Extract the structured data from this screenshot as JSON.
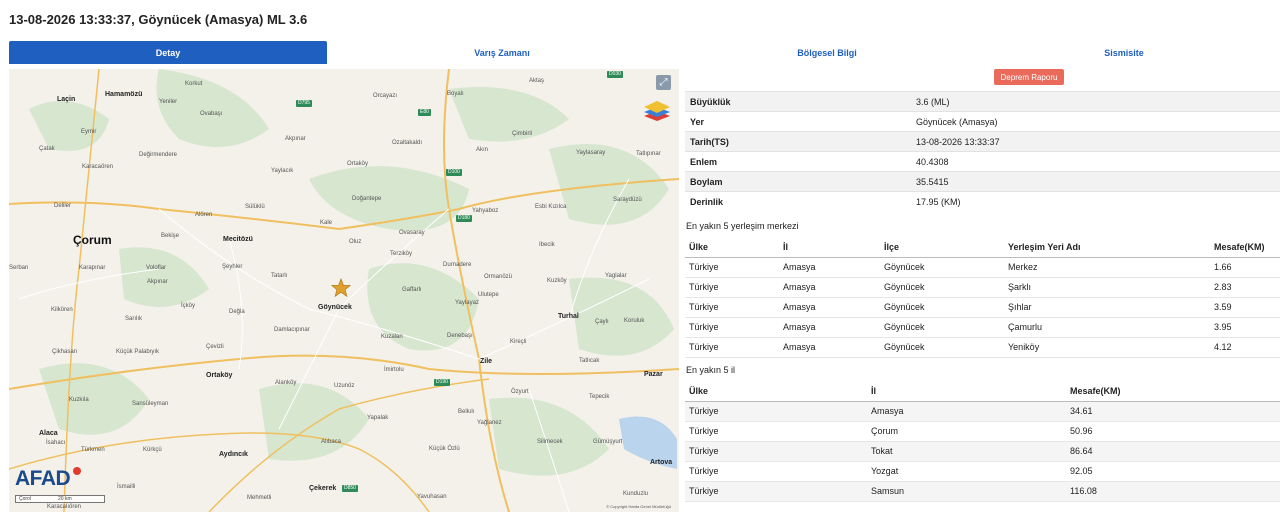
{
  "title": "13-08-2026 13:33:37, Göynücek (Amasya) ML 3.6",
  "tabs": [
    {
      "label": "Detay",
      "active": true
    },
    {
      "label": "Varış Zamanı",
      "active": false
    },
    {
      "label": "Bölgesel Bilgi",
      "active": false
    },
    {
      "label": "Sismisite",
      "active": false
    }
  ],
  "report_button": "Deprem Raporu",
  "info": [
    {
      "key": "Büyüklük",
      "value": "3.6 (ML)"
    },
    {
      "key": "Yer",
      "value": "Göynücek (Amasya)"
    },
    {
      "key": "Tarih(TS)",
      "value": "13-08-2026 13:33:37"
    },
    {
      "key": "Enlem",
      "value": "40.4308"
    },
    {
      "key": "Boylam",
      "value": "35.5415"
    },
    {
      "key": "Derinlik",
      "value": "17.95 (KM)"
    }
  ],
  "nearest_settlements": {
    "title": "En yakın 5 yerleşim merkezi",
    "headers": [
      "Ülke",
      "İl",
      "İlçe",
      "Yerleşim Yeri Adı",
      "Mesafe(KM)"
    ],
    "rows": [
      [
        "Türkiye",
        "Amasya",
        "Göynücek",
        "Merkez",
        "1.66"
      ],
      [
        "Türkiye",
        "Amasya",
        "Göynücek",
        "Şarklı",
        "2.83"
      ],
      [
        "Türkiye",
        "Amasya",
        "Göynücek",
        "Şıhlar",
        "3.59"
      ],
      [
        "Türkiye",
        "Amasya",
        "Göynücek",
        "Çamurlu",
        "3.95"
      ],
      [
        "Türkiye",
        "Amasya",
        "Göynücek",
        "Yeniköy",
        "4.12"
      ]
    ]
  },
  "nearest_provinces": {
    "title": "En yakın 5 il",
    "headers": [
      "Ülke",
      "İl",
      "Mesafe(KM)"
    ],
    "rows": [
      [
        "Türkiye",
        "Amasya",
        "34.61"
      ],
      [
        "Türkiye",
        "Çorum",
        "50.96"
      ],
      [
        "Türkiye",
        "Tokat",
        "86.64"
      ],
      [
        "Türkiye",
        "Yozgat",
        "92.05"
      ],
      [
        "Türkiye",
        "Samsun",
        "116.08"
      ]
    ]
  },
  "map": {
    "logo": "AFAD",
    "scale_left": "Çorol",
    "scale_label": "20 km",
    "copyright": "© Copyright Harita Genel Müdürlüğü",
    "expand_icon": "expand-icon",
    "layers_icon": "layers-icon",
    "epicenter_icon": "star-icon",
    "epicenter_color": "#e0a030",
    "big_labels": [
      "Çorum"
    ],
    "city_labels": [
      "Laçin",
      "Hamamözü",
      "Mecitözü",
      "Göynücek",
      "Turhal",
      "Zile",
      "Ortaköy",
      "Pazar",
      "Alaca",
      "Aydıncık",
      "Artova",
      "Çekerek"
    ],
    "labels": [
      "Korkut",
      "Yeniler",
      "Ovabaşı",
      "Orcayazı",
      "Boyalı",
      "Aktaş",
      "Çimbirli",
      "Eymir",
      "Çatak",
      "Değirmendere",
      "Akpınar",
      "Ozaltakaldı",
      "Akın",
      "Yaylasaray",
      "Tatlıpınar",
      "Karacaören",
      "Sülüklü",
      "Yaylacık",
      "Ortaköy",
      "Doğantepe",
      "Esbi Kızılca",
      "Saraydüzü",
      "Deliler",
      "Alören",
      "Kale",
      "Yahyaboz",
      "Ovasaray",
      "Ibecik",
      "Bekişe",
      "Oluz",
      "Serban",
      "Karapınar",
      "Voloflar",
      "Şeyhler",
      "Tatarlı",
      "Terziköy",
      "Ormanözü",
      "Yaglalar",
      "Akpınar",
      "Durnadere",
      "Kuzköy",
      "Kilkören",
      "Sarılık",
      "İçköy",
      "Değla",
      "Gaffarlı",
      "Yaylayaz",
      "Ulutepe",
      "Çaylı",
      "Koruluk",
      "Damlacıpınar",
      "Kuzalan",
      "Denebaşı",
      "Kireçli",
      "Çikhasan",
      "Küçük Palabıyık",
      "Çevizli",
      "İmirtolu",
      "Tatlıcak",
      "Alanköy",
      "Uzunöz",
      "Özyurt",
      "Tepecik",
      "Kuzkıla",
      "Sansüleyman",
      "Yapalak",
      "Belkılı",
      "Yağlanez",
      "İsahacı",
      "Alıbaca",
      "Silimecek",
      "Gümüşyurt",
      "Türkmen",
      "Kürkçü",
      "Küçük Özlü",
      "İsmailli",
      "Mehmetli",
      "Yavuhasan",
      "Kunduzlu",
      "Karacalıören"
    ],
    "roads": [
      "D795",
      "D030",
      "E80",
      "D100",
      "D180",
      "D190",
      "D850"
    ]
  }
}
